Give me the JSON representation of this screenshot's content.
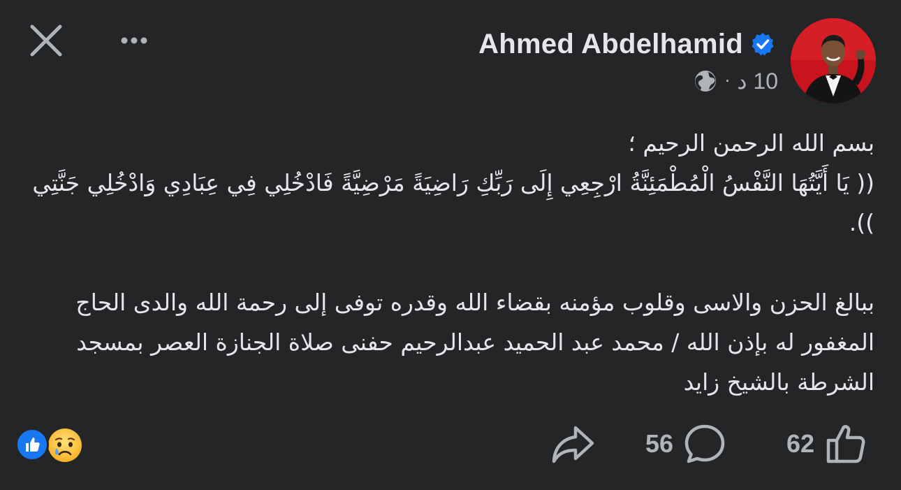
{
  "header": {
    "author_name": "Ahmed Abdelhamid",
    "time": "10 د",
    "separator": "·",
    "verified_icon": "verified-badge-icon",
    "audience_icon": "globe-icon"
  },
  "toolbar": {
    "close_icon": "close-icon",
    "more_icon": "more-options-icon"
  },
  "post": {
    "paragraph_1": "بسم الله الرحمن الرحيم ؛\n(( يَا أَيَّتُهَا النَّفْسُ الْمُطْمَئِنَّةُ ارْجِعِي إِلَى رَبِّكِ رَاضِيَةً مَرْضِيَّةً فَادْخُلِي فِي عِبَادِي وَادْخُلِي جَنَّتِي )).",
    "paragraph_2": "ببالغ  الحزن والاسى وقلوب مؤمنه بقضاء الله وقدره توفى إلى رحمة الله والدى الحاج المغفور له بإذن الله / محمد عبد الحميد عبدالرحيم حفنى صلاة الجنازة العصر بمسجد الشرطة بالشيخ زايد"
  },
  "footer": {
    "reactions": [
      "like-reaction-icon",
      "sad-reaction-icon"
    ],
    "like_count": "62",
    "comment_count": "56",
    "share_icon": "share-icon",
    "comment_icon": "comment-icon",
    "like_icon": "like-icon"
  },
  "colors": {
    "background": "#242526",
    "text_primary": "#e4e6eb",
    "text_secondary": "#b0b3b8",
    "accent_blue": "#1877f2"
  }
}
